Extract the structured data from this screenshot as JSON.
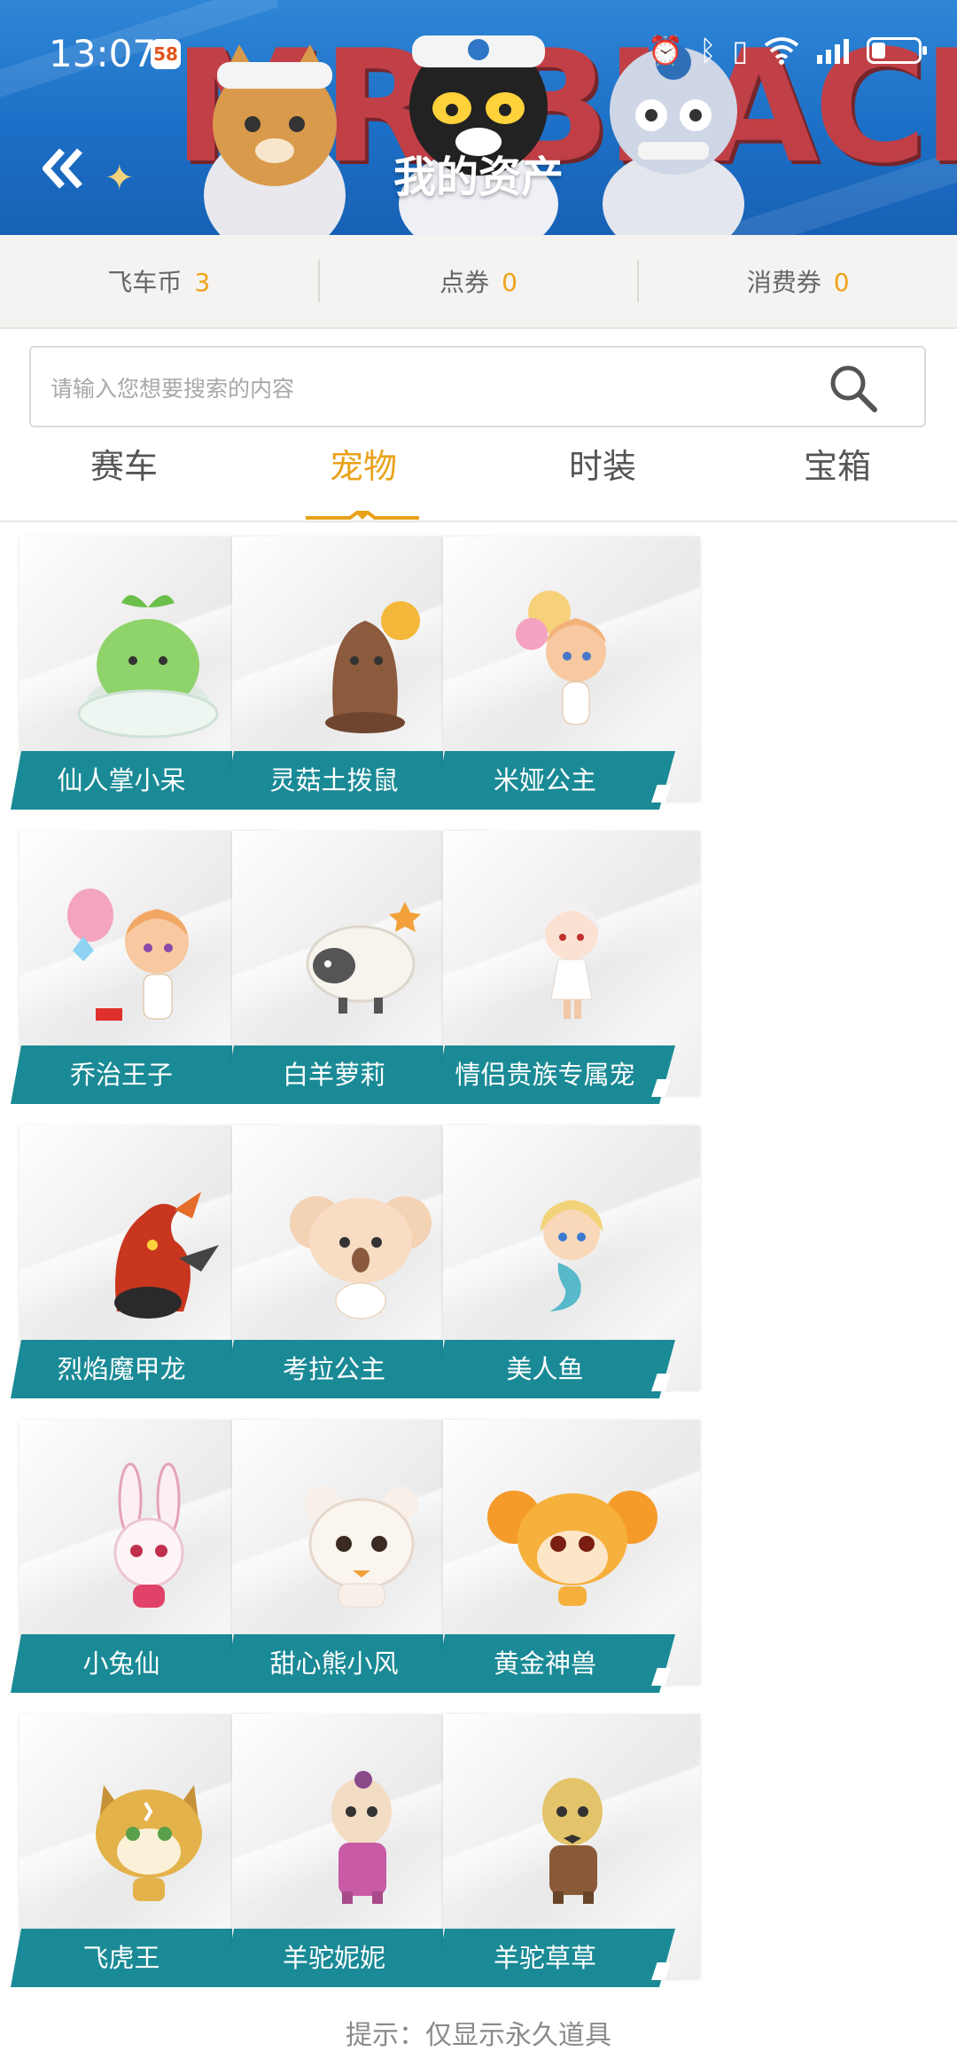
{
  "status_bar": {
    "time": "13:07",
    "app_badge": "58",
    "icons": [
      "alarm-icon",
      "bluetooth-icon",
      "vibrate-icon",
      "wifi-icon",
      "signal-icon",
      "battery-icon"
    ],
    "battery_level": 0.3
  },
  "header": {
    "banner_text": "MR.BLACK",
    "title": "我的资产",
    "back_icon": "double-chevron-left-icon"
  },
  "currencies": [
    {
      "label": "飞车币",
      "value": "3"
    },
    {
      "label": "点券",
      "value": "0"
    },
    {
      "label": "消费券",
      "value": "0"
    }
  ],
  "search": {
    "placeholder": "请输入您想要搜索的内容",
    "value": ""
  },
  "tabs": [
    {
      "label": "赛车",
      "active": false
    },
    {
      "label": "宠物",
      "active": true
    },
    {
      "label": "时装",
      "active": false
    },
    {
      "label": "宝箱",
      "active": false
    }
  ],
  "pets": [
    {
      "name": "仙人掌小呆",
      "icon": "cactus-pet-icon"
    },
    {
      "name": "灵菇土拨鼠",
      "icon": "mushroom-groundhog-pet-icon"
    },
    {
      "name": "米娅公主",
      "icon": "princess-mia-pet-icon"
    },
    {
      "name": "乔治王子",
      "icon": "prince-george-pet-icon"
    },
    {
      "name": "白羊萝莉",
      "icon": "white-sheep-pet-icon"
    },
    {
      "name": "情侣贵族专属宠",
      "icon": "noble-couple-pet-icon"
    },
    {
      "name": "烈焰魔甲龙",
      "icon": "flame-dragon-pet-icon"
    },
    {
      "name": "考拉公主",
      "icon": "koala-princess-pet-icon"
    },
    {
      "name": "美人鱼",
      "icon": "mermaid-pet-icon"
    },
    {
      "name": "小兔仙",
      "icon": "bunny-fairy-pet-icon"
    },
    {
      "name": "甜心熊小风",
      "icon": "sweet-bear-pet-icon"
    },
    {
      "name": "黄金神兽",
      "icon": "golden-beast-pet-icon"
    },
    {
      "name": "飞虎王",
      "icon": "flying-tiger-pet-icon"
    },
    {
      "name": "羊驼妮妮",
      "icon": "alpaca-nini-pet-icon"
    },
    {
      "name": "羊驼草草",
      "icon": "alpaca-caocao-pet-icon"
    }
  ],
  "footer_hint": "提示：仅显示永久道具",
  "colors": {
    "accent": "#E8A21A",
    "banner_teal": "#1A8A96",
    "header_blue": "#1C6FC6"
  }
}
